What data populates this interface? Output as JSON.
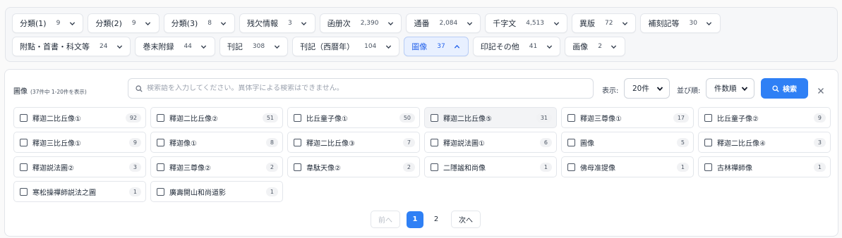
{
  "facets": [
    {
      "label": "分類(1)",
      "count": "9"
    },
    {
      "label": "分類(2)",
      "count": "9"
    },
    {
      "label": "分類(3)",
      "count": "8"
    },
    {
      "label": "残欠情報",
      "count": "3"
    },
    {
      "label": "函册次",
      "count": "2,390"
    },
    {
      "label": "通番",
      "count": "2,084"
    },
    {
      "label": "千字文",
      "count": "4,513"
    },
    {
      "label": "異版",
      "count": "72"
    },
    {
      "label": "補刻記等",
      "count": "30"
    },
    {
      "label": "附點・首書・科文等",
      "count": "24"
    },
    {
      "label": "巻末附録",
      "count": "44"
    },
    {
      "label": "刊記",
      "count": "308"
    },
    {
      "label": "刊記（西暦年）",
      "count": "104"
    },
    {
      "label": "圖像",
      "count": "37",
      "active": true
    },
    {
      "label": "印記その他",
      "count": "41"
    },
    {
      "label": "画像",
      "count": "2"
    }
  ],
  "panel": {
    "title": "圖像",
    "subtitle": "(37件中 1-20件を表示)",
    "search_placeholder": "検索語を入力してください。異体字による検索はできません。",
    "display_label": "表示:",
    "display_value": "20件",
    "sort_label": "並び順:",
    "sort_value": "件数順",
    "search_button": "検索"
  },
  "items": [
    {
      "label": "釋迦二比丘像①",
      "count": "92"
    },
    {
      "label": "釋迦二比丘像②",
      "count": "51"
    },
    {
      "label": "比丘童子像①",
      "count": "50"
    },
    {
      "label": "釋迦二比丘像⑤",
      "count": "31",
      "highlight": true
    },
    {
      "label": "釋迦三尊像①",
      "count": "17"
    },
    {
      "label": "比丘童子像②",
      "count": "9"
    },
    {
      "label": "釋迦三比丘像①",
      "count": "9"
    },
    {
      "label": "釋迦像①",
      "count": "8"
    },
    {
      "label": "釋迦二比丘像③",
      "count": "7"
    },
    {
      "label": "釋迦説法圖①",
      "count": "6"
    },
    {
      "label": "圖像",
      "count": "5"
    },
    {
      "label": "釋迦二比丘像④",
      "count": "3"
    },
    {
      "label": "釋迦説法圖②",
      "count": "3"
    },
    {
      "label": "釋迦三尊像②",
      "count": "2"
    },
    {
      "label": "韋駄天像②",
      "count": "2"
    },
    {
      "label": "二隱謐和尚像",
      "count": "1"
    },
    {
      "label": "佛母准提像",
      "count": "1"
    },
    {
      "label": "古林禪師像",
      "count": "1"
    },
    {
      "label": "寒松操禪師説法之圖",
      "count": "1"
    },
    {
      "label": "廣壽開山和尚道影",
      "count": "1"
    }
  ],
  "pagination": {
    "prev": "前へ",
    "pages": [
      "1",
      "2"
    ],
    "current": "1",
    "next": "次へ"
  },
  "colors": {
    "accent": "#2f80f5",
    "active_chip_bg": "#e8f0ff"
  },
  "icons": {
    "search": "search-icon",
    "chevron": "chevron-down-icon",
    "close": "close-icon"
  }
}
